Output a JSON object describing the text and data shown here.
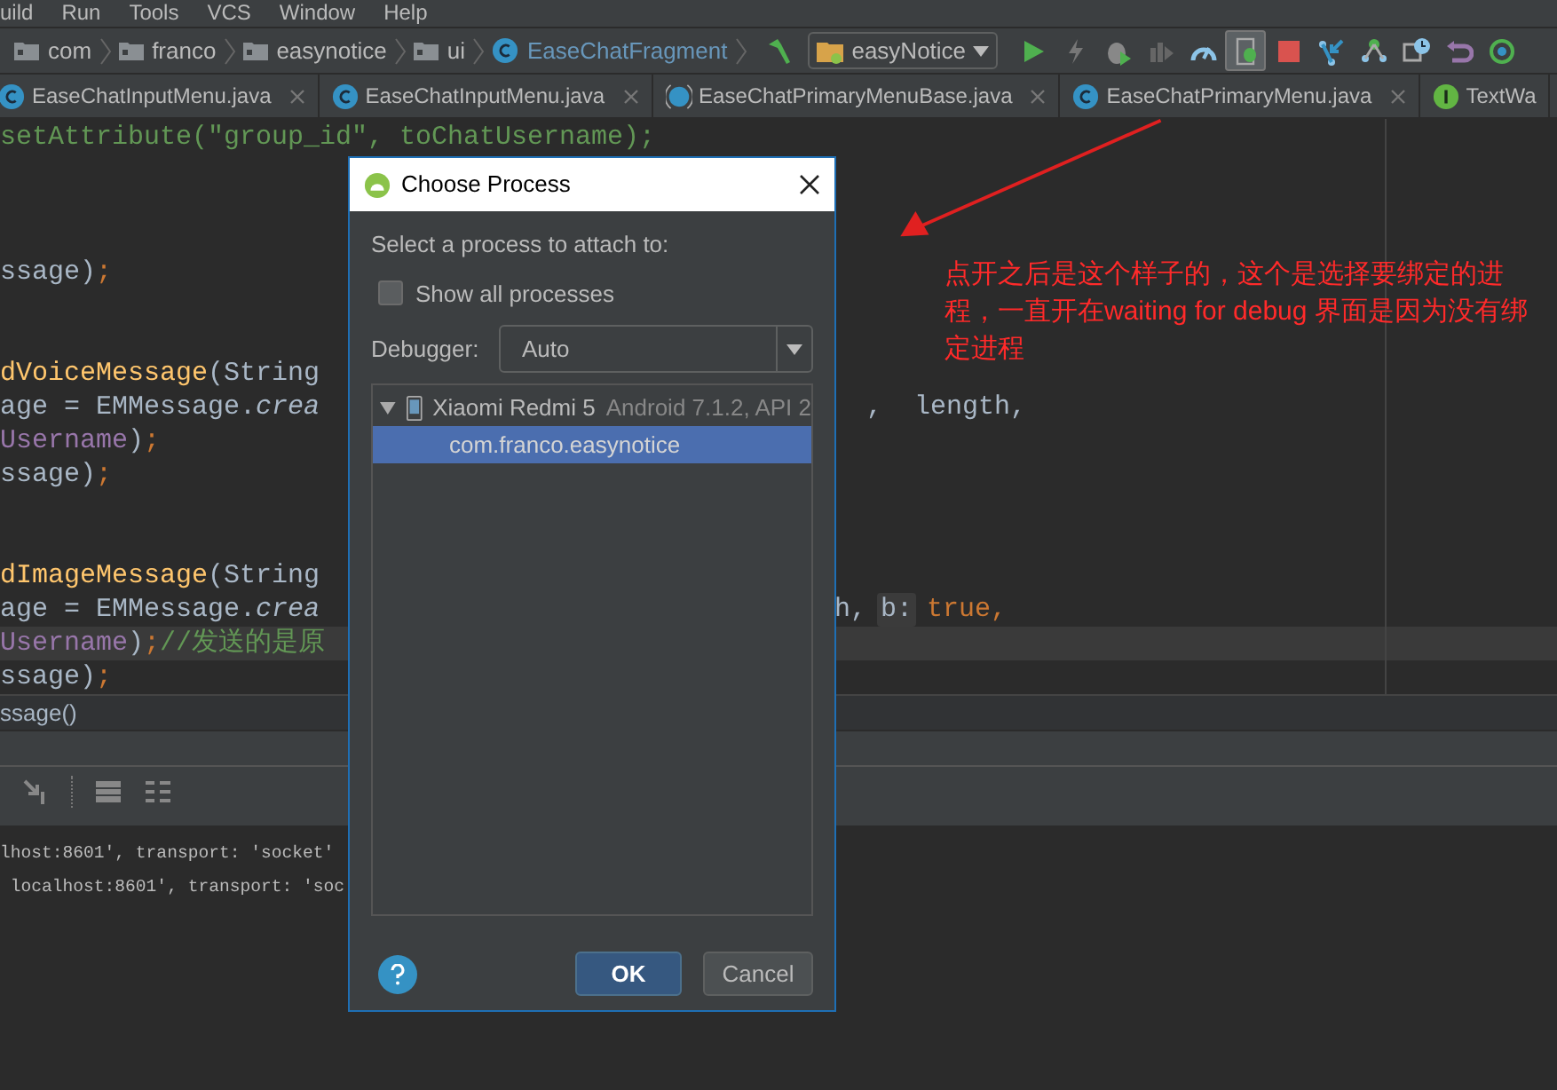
{
  "menu_bar": [
    "uild",
    "Run",
    "Tools",
    "VCS",
    "Window",
    "Help"
  ],
  "breadcrumbs": [
    {
      "label": "com",
      "kind": "folder"
    },
    {
      "label": "franco",
      "kind": "folder"
    },
    {
      "label": "easynotice",
      "kind": "folder"
    },
    {
      "label": "ui",
      "kind": "folder"
    },
    {
      "label": "EaseChatFragment",
      "kind": "class"
    }
  ],
  "run_config": "easyNotice",
  "toolbar": [
    {
      "kind": "run",
      "selected": false
    },
    {
      "kind": "apply",
      "selected": false
    },
    {
      "kind": "debug",
      "selected": false
    },
    {
      "kind": "coverage",
      "selected": false
    },
    {
      "kind": "profile",
      "selected": false
    },
    {
      "kind": "attach",
      "selected": true
    },
    {
      "kind": "stop",
      "selected": false
    },
    {
      "kind": "vcs-update",
      "selected": false
    },
    {
      "kind": "vcs-commit",
      "selected": false
    },
    {
      "kind": "history",
      "selected": false
    },
    {
      "kind": "revert",
      "selected": false
    },
    {
      "kind": "sync",
      "selected": false
    }
  ],
  "tabs": [
    {
      "label": "EaseChatInputMenu.java",
      "kind": "class",
      "closable": true
    },
    {
      "label": "EaseChatInputMenu.java",
      "kind": "class",
      "closable": true
    },
    {
      "label": "EaseChatPrimaryMenuBase.java",
      "kind": "abstract",
      "closable": true
    },
    {
      "label": "EaseChatPrimaryMenu.java",
      "kind": "class",
      "closable": true
    },
    {
      "label": "TextWa",
      "kind": "interface",
      "closable": false
    }
  ],
  "code_lines": [
    {
      "current": false,
      "left": [
        {
          "text": "setAttribute(\"group_id\", toChatUsername);",
          "kind": "comment"
        }
      ]
    },
    {
      "current": false
    },
    {
      "current": false
    },
    {
      "current": false
    },
    {
      "current": false,
      "left": [
        {
          "text": "ssage)",
          "kind": "plain"
        },
        {
          "text": ";",
          "kind": "keyword"
        }
      ]
    },
    {
      "current": false
    },
    {
      "current": false
    },
    {
      "current": false,
      "left": [
        {
          "text": "dVoiceMessage",
          "kind": "method"
        },
        {
          "text": "(String",
          "kind": "plain"
        }
      ]
    },
    {
      "current": false,
      "left": [
        {
          "text": "age = EMMessage.",
          "kind": "plain"
        },
        {
          "text": "crea",
          "kind": "static"
        }
      ],
      "right": [
        {
          "text": "  ,  length,",
          "kind": "plain"
        }
      ]
    },
    {
      "current": false,
      "left": [
        {
          "text": "Username",
          "kind": "field"
        },
        {
          "text": ")",
          "kind": "plain"
        },
        {
          "text": ";",
          "kind": "keyword"
        }
      ]
    },
    {
      "current": false,
      "left": [
        {
          "text": "ssage)",
          "kind": "plain"
        },
        {
          "text": ";",
          "kind": "keyword"
        }
      ]
    },
    {
      "current": false
    },
    {
      "current": false
    },
    {
      "current": false,
      "left": [
        {
          "text": "dImageMessage",
          "kind": "method"
        },
        {
          "text": "(String",
          "kind": "plain"
        }
      ]
    },
    {
      "current": false,
      "left": [
        {
          "text": "age = EMMessage.",
          "kind": "plain"
        },
        {
          "text": "crea",
          "kind": "static"
        }
      ],
      "right": [
        {
          "text": "h,",
          "kind": "plain"
        },
        {
          "text": "b:",
          "kind": "hint"
        },
        {
          "text": "true,",
          "kind": "keyword"
        }
      ]
    },
    {
      "current": true,
      "left": [
        {
          "text": "Username",
          "kind": "field"
        },
        {
          "text": ")",
          "kind": "plain"
        },
        {
          "text": ";",
          "kind": "keyword"
        },
        {
          "text": "//发送的是原",
          "kind": "comment"
        }
      ]
    },
    {
      "current": false,
      "left": [
        {
          "text": "ssage)",
          "kind": "plain"
        },
        {
          "text": ";",
          "kind": "keyword"
        }
      ]
    }
  ],
  "method_breadcrumb": "ssage()",
  "console_lines": [
    "lhost:8601', transport: 'socket'",
    " localhost:8601', transport: 'soc"
  ],
  "dialog": {
    "title": "Choose Process",
    "prompt": "Select a process to attach to:",
    "show_all": {
      "label": "Show all processes",
      "checked": false
    },
    "debugger": {
      "label": "Debugger:",
      "value": "Auto"
    },
    "devices": [
      {
        "name": "Xiaomi Redmi 5",
        "detail": "Android 7.1.2, API 2",
        "expanded": true,
        "processes": [
          {
            "name": "com.franco.easynotice",
            "selected": true
          }
        ]
      }
    ],
    "buttons": [
      {
        "label": "OK",
        "default": true
      },
      {
        "label": "Cancel",
        "default": false
      }
    ]
  },
  "annotation": "点开之后是这个样子的，这个是选择要绑定的进程，一直开在waiting for debug 界面是因为没有绑定进程"
}
